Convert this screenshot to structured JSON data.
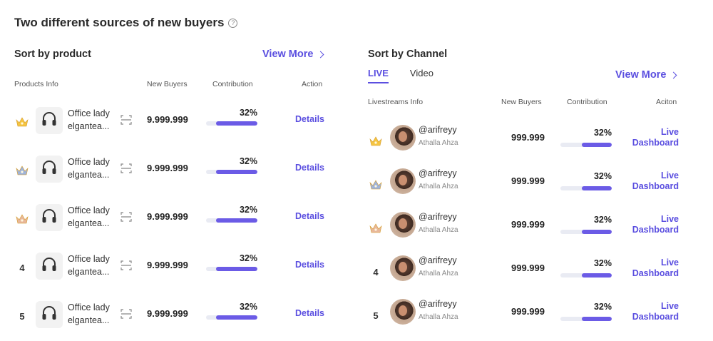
{
  "page": {
    "title": "Two different sources of new buyers",
    "help_icon": "?"
  },
  "colors": {
    "accent": "#5b4fe0",
    "bar_fill": "#6b5be6",
    "bar_track": "#e9ebf3",
    "gold": "#f5c542",
    "silver": "#9fb3d9",
    "bronze": "#e8b79a"
  },
  "product_panel": {
    "title": "Sort by product",
    "view_more": "View More",
    "headers": {
      "info": "Products Info",
      "buyers": "New Buyers",
      "contribution": "Contribution",
      "action": "Action"
    },
    "rows": [
      {
        "rank": "1",
        "rank_icon": "gold-crown-icon",
        "name_line1": "Office lady",
        "name_line2": "elgantea...",
        "buyers": "9.999.999",
        "contribution": "32%",
        "contribution_value": 0.32,
        "action": "Details"
      },
      {
        "rank": "2",
        "rank_icon": "silver-crown-icon",
        "name_line1": "Office lady",
        "name_line2": "elgantea...",
        "buyers": "9.999.999",
        "contribution": "32%",
        "contribution_value": 0.32,
        "action": "Details"
      },
      {
        "rank": "3",
        "rank_icon": "bronze-crown-icon",
        "name_line1": "Office lady",
        "name_line2": "elgantea...",
        "buyers": "9.999.999",
        "contribution": "32%",
        "contribution_value": 0.32,
        "action": "Details"
      },
      {
        "rank": "4",
        "rank_icon": "",
        "name_line1": "Office lady",
        "name_line2": "elgantea...",
        "buyers": "9.999.999",
        "contribution": "32%",
        "contribution_value": 0.32,
        "action": "Details"
      },
      {
        "rank": "5",
        "rank_icon": "",
        "name_line1": "Office lady",
        "name_line2": "elgantea...",
        "buyers": "9.999.999",
        "contribution": "32%",
        "contribution_value": 0.32,
        "action": "Details"
      }
    ]
  },
  "channel_panel": {
    "title": "Sort by Channel",
    "view_more": "View More",
    "tabs": [
      {
        "label": "LIVE",
        "active": true
      },
      {
        "label": "Video",
        "active": false
      }
    ],
    "headers": {
      "info": "Livestreams Info",
      "buyers": "New Buyers",
      "contribution": "Contribution",
      "action": "Aciton"
    },
    "rows": [
      {
        "rank": "1",
        "rank_icon": "gold-crown-icon",
        "handle": "@arifreyy",
        "name": "Athalla Ahza",
        "buyers": "999.999",
        "contribution": "32%",
        "contribution_value": 0.32,
        "action_line1": "Live",
        "action_line2": "Dashboard"
      },
      {
        "rank": "2",
        "rank_icon": "silver-crown-icon",
        "handle": "@arifreyy",
        "name": "Athalla Ahza",
        "buyers": "999.999",
        "contribution": "32%",
        "contribution_value": 0.32,
        "action_line1": "Live",
        "action_line2": "Dashboard"
      },
      {
        "rank": "3",
        "rank_icon": "bronze-crown-icon",
        "handle": "@arifreyy",
        "name": "Athalla Ahza",
        "buyers": "999.999",
        "contribution": "32%",
        "contribution_value": 0.32,
        "action_line1": "Live",
        "action_line2": "Dashboard"
      },
      {
        "rank": "4",
        "rank_icon": "",
        "handle": "@arifreyy",
        "name": "Athalla Ahza",
        "buyers": "999.999",
        "contribution": "32%",
        "contribution_value": 0.32,
        "action_line1": "Live",
        "action_line2": "Dashboard"
      },
      {
        "rank": "5",
        "rank_icon": "",
        "handle": "@arifreyy",
        "name": "Athalla Ahza",
        "buyers": "999.999",
        "contribution": "32%",
        "contribution_value": 0.32,
        "action_line1": "Live",
        "action_line2": "Dashboard"
      }
    ]
  }
}
